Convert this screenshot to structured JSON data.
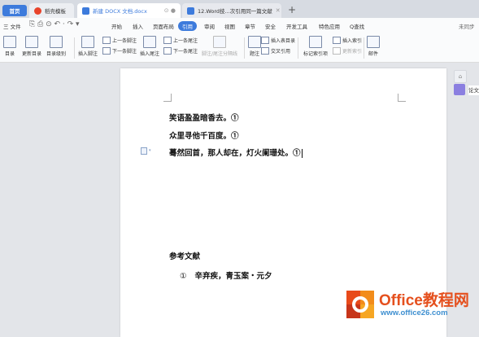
{
  "tabs": {
    "home": "首页",
    "shell": "稻壳模板",
    "doc1": "新建 DOCX 文档.docx",
    "doc2": "12.Word技...次引用同一篇文献",
    "new_tab": "+"
  },
  "menu": {
    "file": "三 文件",
    "items": [
      "开始",
      "插入",
      "页面布局",
      "引用",
      "审阅",
      "视图",
      "章节",
      "安全",
      "开发工具",
      "特色应用"
    ],
    "selected": "引用",
    "search": "Q查找",
    "sync": "未同步"
  },
  "ribbon": {
    "toc": "目录",
    "update_toc": "更新目录",
    "toc_level": "目录级别",
    "insert_footnote": "插入脚注",
    "prev_footnote": "上一条脚注",
    "next_footnote": "下一条脚注",
    "insert_endnote": "插入尾注",
    "prev_endnote": "上一条尾注",
    "next_endnote": "下一条尾注",
    "footnote_sep": "脚注/尾注分隔线",
    "caption": "题注",
    "insert_toc_table": "插入表目录",
    "cross_ref": "交叉引用",
    "mark_index": "标记索引项",
    "insert_index": "插入索引",
    "update_index": "更新索引",
    "mail": "邮件"
  },
  "document": {
    "lines": [
      "笑语盈盈暗香去。①",
      "众里寻他千百度。①",
      "蓦然回首，那人却在，灯火阑珊处。①"
    ],
    "ref_title": "参考文献",
    "ref_num": "①",
    "ref_text": "辛弃疾，青玉案・元夕"
  },
  "side_panel": {
    "paper": "论文"
  },
  "watermark": {
    "brand": "Office教程网",
    "url": "www.office26.com"
  },
  "colors": {
    "accent": "#3d7bdc",
    "brand_orange": "#e5501e",
    "brand_blue": "#3e8fd0"
  }
}
